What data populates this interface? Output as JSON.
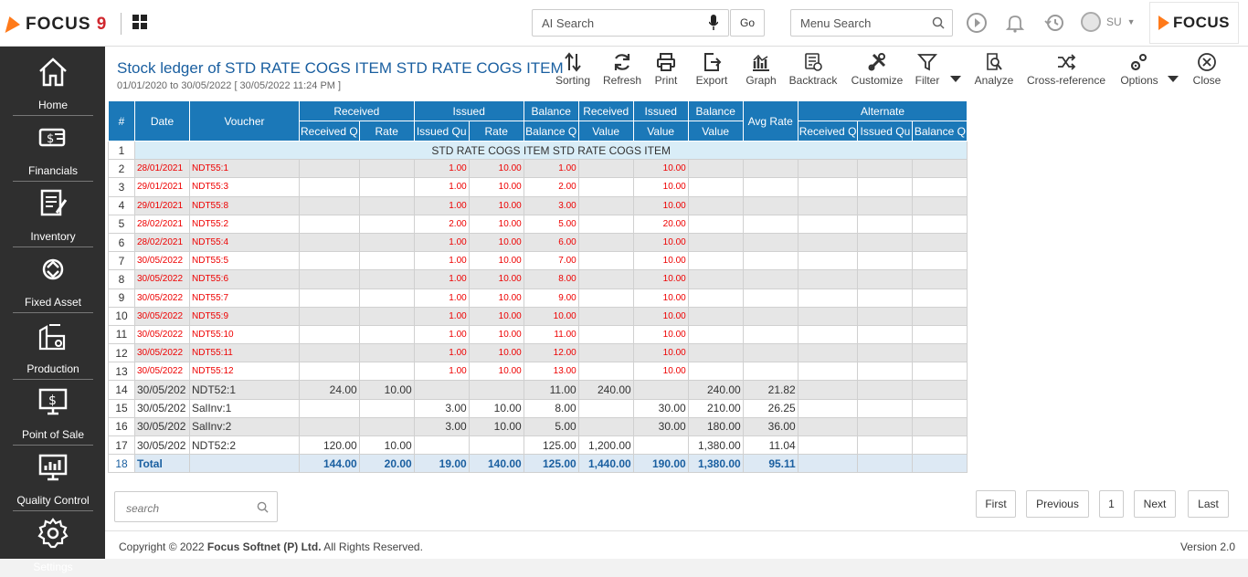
{
  "app": {
    "logo_text": "FOCUS",
    "logo_num": "9",
    "brand_text": "FOCUS",
    "user": "SU"
  },
  "header": {
    "ai_search_placeholder": "AI Search",
    "go_label": "Go",
    "menu_search_placeholder": "Menu Search"
  },
  "sidebar": {
    "items": [
      {
        "label": "Home",
        "icon": "home-icon"
      },
      {
        "label": "Financials",
        "icon": "financials-icon"
      },
      {
        "label": "Inventory",
        "icon": "inventory-icon"
      },
      {
        "label": "Fixed Asset",
        "icon": "fixed-asset-icon"
      },
      {
        "label": "Production",
        "icon": "production-icon"
      },
      {
        "label": "Point of Sale",
        "icon": "point-of-sale-icon"
      },
      {
        "label": "Quality Control",
        "icon": "quality-control-icon"
      },
      {
        "label": "Settings",
        "icon": "gear-icon"
      }
    ]
  },
  "report": {
    "title": "Stock ledger of STD RATE COGS ITEM STD RATE COGS ITEM",
    "subtitle": "01/01/2020 to 30/05/2022 [ 30/05/2022 11:24 PM ]"
  },
  "toolbar": {
    "sorting": "Sorting",
    "refresh": "Refresh",
    "print": "Print",
    "export": "Export",
    "graph": "Graph",
    "backtrack": "Backtrack",
    "customize": "Customize",
    "filter": "Filter",
    "analyze": "Analyze",
    "cross_reference": "Cross-reference",
    "options": "Options",
    "close": "Close"
  },
  "grid": {
    "headers": {
      "num": "#",
      "date": "Date",
      "voucher": "Voucher",
      "received": "Received",
      "issued": "Issued",
      "balance": "Balance",
      "received2": "Received",
      "issued2": "Issued",
      "balance2": "Balance",
      "avg_rate": "Avg Rate",
      "alternate": "Alternate"
    },
    "subheaders": [
      "Received Q",
      "Rate",
      "Issued Qu",
      "Rate",
      "Balance Q",
      "Value",
      "Value",
      "Value",
      "Received Q",
      "Issued Qu",
      "Balance Q"
    ],
    "group_label": "STD RATE COGS ITEM STD RATE COGS ITEM",
    "rows": [
      [
        "2",
        "28/01/2021",
        "NDT55:1",
        "",
        "",
        "1.00",
        "10.00",
        "1.00",
        "",
        "10.00",
        "",
        "",
        "",
        "",
        ""
      ],
      [
        "3",
        "29/01/2021",
        "NDT55:3",
        "",
        "",
        "1.00",
        "10.00",
        "2.00",
        "",
        "10.00",
        "",
        "",
        "",
        "",
        ""
      ],
      [
        "4",
        "29/01/2021",
        "NDT55:8",
        "",
        "",
        "1.00",
        "10.00",
        "3.00",
        "",
        "10.00",
        "",
        "",
        "",
        "",
        ""
      ],
      [
        "5",
        "28/02/2021",
        "NDT55:2",
        "",
        "",
        "2.00",
        "10.00",
        "5.00",
        "",
        "20.00",
        "",
        "",
        "",
        "",
        ""
      ],
      [
        "6",
        "28/02/2021",
        "NDT55:4",
        "",
        "",
        "1.00",
        "10.00",
        "6.00",
        "",
        "10.00",
        "",
        "",
        "",
        "",
        ""
      ],
      [
        "7",
        "30/05/2022",
        "NDT55:5",
        "",
        "",
        "1.00",
        "10.00",
        "7.00",
        "",
        "10.00",
        "",
        "",
        "",
        "",
        ""
      ],
      [
        "8",
        "30/05/2022",
        "NDT55:6",
        "",
        "",
        "1.00",
        "10.00",
        "8.00",
        "",
        "10.00",
        "",
        "",
        "",
        "",
        ""
      ],
      [
        "9",
        "30/05/2022",
        "NDT55:7",
        "",
        "",
        "1.00",
        "10.00",
        "9.00",
        "",
        "10.00",
        "",
        "",
        "",
        "",
        ""
      ],
      [
        "10",
        "30/05/2022",
        "NDT55:9",
        "",
        "",
        "1.00",
        "10.00",
        "10.00",
        "",
        "10.00",
        "",
        "",
        "",
        "",
        ""
      ],
      [
        "11",
        "30/05/2022",
        "NDT55:10",
        "",
        "",
        "1.00",
        "10.00",
        "11.00",
        "",
        "10.00",
        "",
        "",
        "",
        "",
        ""
      ],
      [
        "12",
        "30/05/2022",
        "NDT55:11",
        "",
        "",
        "1.00",
        "10.00",
        "12.00",
        "",
        "10.00",
        "",
        "",
        "",
        "",
        ""
      ],
      [
        "13",
        "30/05/2022",
        "NDT55:12",
        "",
        "",
        "1.00",
        "10.00",
        "13.00",
        "",
        "10.00",
        "",
        "",
        "",
        "",
        ""
      ],
      [
        "14",
        "30/05/202",
        "NDT52:1",
        "24.00",
        "10.00",
        "",
        "",
        "11.00",
        "240.00",
        "",
        "240.00",
        "21.82",
        "",
        "",
        ""
      ],
      [
        "15",
        "30/05/202",
        "SalInv:1",
        "",
        "",
        "3.00",
        "10.00",
        "8.00",
        "",
        "30.00",
        "210.00",
        "26.25",
        "",
        "",
        ""
      ],
      [
        "16",
        "30/05/202",
        "SalInv:2",
        "",
        "",
        "3.00",
        "10.00",
        "5.00",
        "",
        "30.00",
        "180.00",
        "36.00",
        "",
        "",
        ""
      ],
      [
        "17",
        "30/05/202",
        "NDT52:2",
        "120.00",
        "10.00",
        "",
        "",
        "125.00",
        "1,200.00",
        "",
        "1,380.00",
        "11.04",
        "",
        "",
        ""
      ]
    ],
    "total": [
      "18",
      "Total",
      "",
      "144.00",
      "20.00",
      "19.00",
      "140.00",
      "125.00",
      "1,440.00",
      "190.00",
      "1,380.00",
      "95.11",
      "",
      "",
      ""
    ]
  },
  "search": {
    "placeholder": "search"
  },
  "pagination": {
    "first": "First",
    "previous": "Previous",
    "page": "1",
    "next": "Next",
    "last": "Last"
  },
  "footer": {
    "copyright_prefix": "Copyright © 2022 ",
    "company": "Focus Softnet (P) Ltd.",
    "rights": " All Rights Reserved.",
    "version": "Version 2.0"
  }
}
